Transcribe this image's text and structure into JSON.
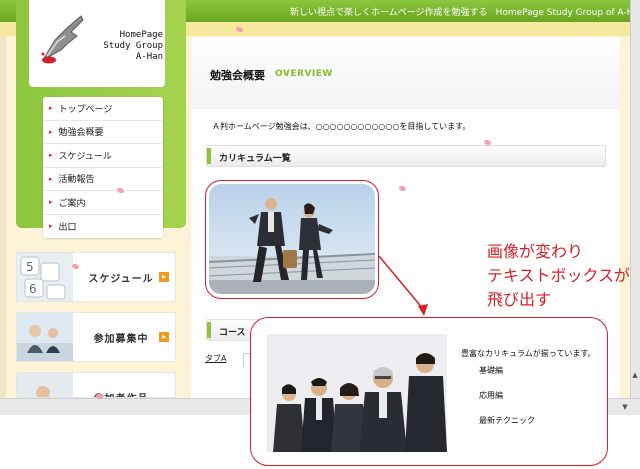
{
  "header": {
    "tagline": "新しい視点で楽しくホームページ作成を勉強する",
    "tagline_en": "HomePage Study Group of A-Han"
  },
  "logo": {
    "line1": "HomePage",
    "line2": "Study Group",
    "line3": "A-Han"
  },
  "nav": {
    "items": [
      {
        "label": "トップページ"
      },
      {
        "label": "勉強会概要"
      },
      {
        "label": "スケジュール"
      },
      {
        "label": "活動報告"
      },
      {
        "label": "ご案内"
      },
      {
        "label": "出口"
      }
    ]
  },
  "banners": [
    {
      "label": "スケジュール"
    },
    {
      "label": "参加募集中"
    },
    {
      "label": "参加者作品"
    }
  ],
  "main": {
    "title": "勉強会概要",
    "subtitle": "OVERVIEW",
    "intro": "Ａ判ホームページ勉強会は、○○○○○○○○○○○○を目指しています。",
    "section1": "カリキュラム一覧",
    "section2": "コース",
    "tab_a": "タブA"
  },
  "annotation": {
    "line1": "画像が変わり",
    "line2": "テキストボックスが",
    "line3": "飛び出す"
  },
  "popup": {
    "lead": "豊富なカリキュラムが揃っています。",
    "items": [
      "基礎編",
      "応用編",
      "最新テクニック"
    ]
  },
  "colors": {
    "green": "#8cc63e",
    "accent_red": "#d61f26",
    "nav_bullet": "#d8222a",
    "banner_arrow": "#f29a1c"
  }
}
